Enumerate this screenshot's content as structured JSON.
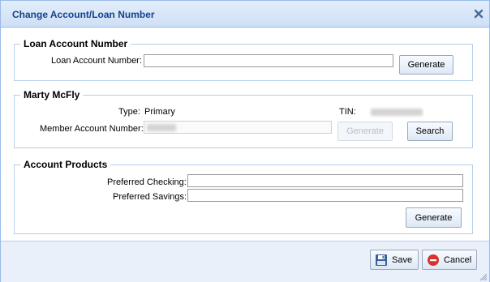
{
  "dialog": {
    "title": "Change Account/Loan Number"
  },
  "loan_section": {
    "legend": "Loan Account Number",
    "field_label": "Loan Account Number:",
    "field_value": "",
    "generate_label": "Generate"
  },
  "member_section": {
    "legend": "Marty McFly",
    "type_label": "Type:",
    "type_value": "Primary",
    "tin_label": "TIN:",
    "member_label": "Member Account Number:",
    "generate_label": "Generate",
    "search_label": "Search"
  },
  "products_section": {
    "legend": "Account Products",
    "checking_label": "Preferred Checking:",
    "checking_value": "",
    "savings_label": "Preferred Savings:",
    "savings_value": "",
    "generate_label": "Generate"
  },
  "footer": {
    "save_label": "Save",
    "cancel_label": "Cancel"
  },
  "icons": {
    "close": "close-icon",
    "save": "floppy-disk-icon",
    "cancel": "cancel-circle-icon",
    "resize": "resize-grip-icon"
  },
  "colors": {
    "title_text": "#15428b",
    "border": "#99bbe8",
    "cancel_red": "#d9322f"
  }
}
